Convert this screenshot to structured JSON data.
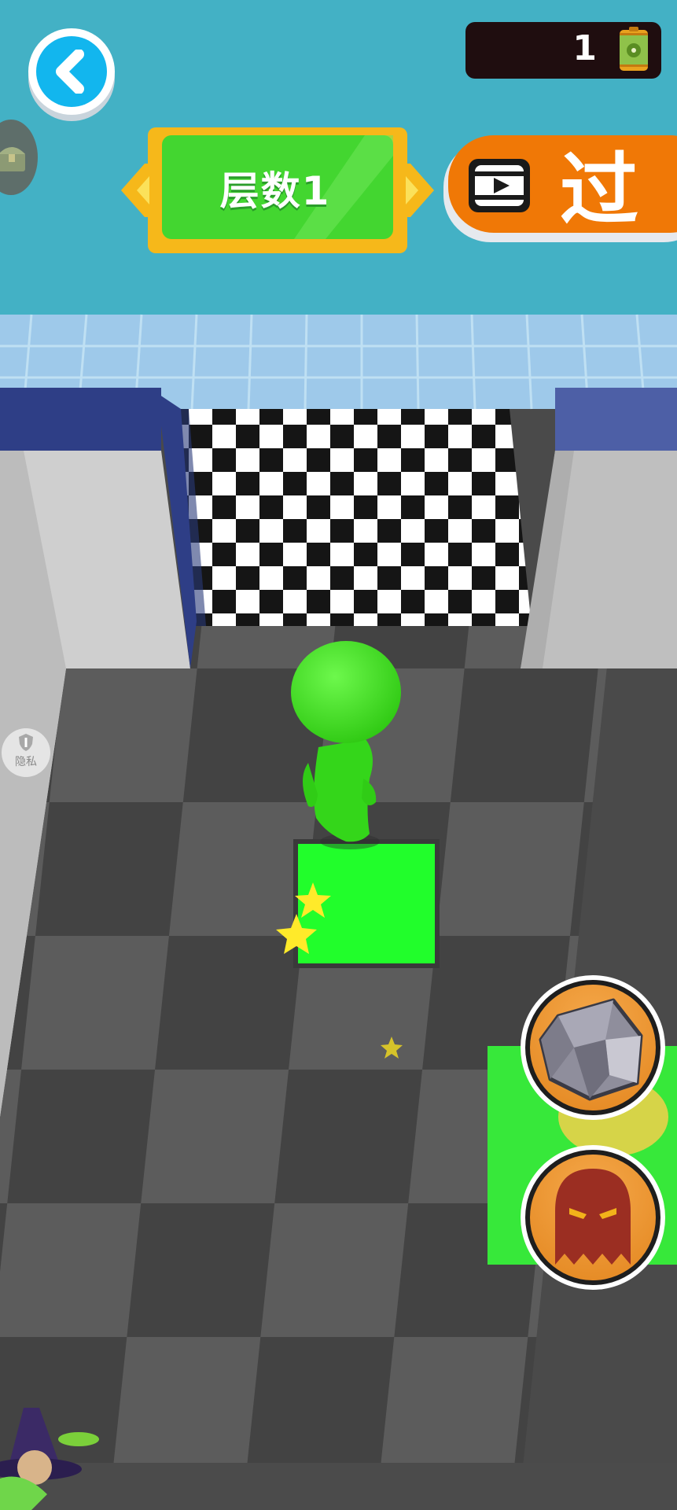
{
  "hud": {
    "back_icon": "chevron-left-icon",
    "coin_count": "1",
    "coin_icon": "toxic-barrel-icon",
    "chest_icon": "treasure-chest-icon",
    "level_label": "层数1",
    "skip_button": {
      "icon": "video-play-icon",
      "label": "过"
    },
    "privacy_label": "隐私"
  },
  "abilities": [
    {
      "name": "rock-ability",
      "icon": "rock-icon"
    },
    {
      "name": "ghost-ability",
      "icon": "ghost-icon"
    }
  ],
  "colors": {
    "sky": "#43b1c5",
    "level_green": "#43d630",
    "level_frame": "#f6b81a",
    "skip_orange": "#f07806",
    "player_green": "#3be41c",
    "pad_green": "#21fe2b",
    "ability_orange": "#eb9433",
    "back_blue": "#12b6ee"
  }
}
